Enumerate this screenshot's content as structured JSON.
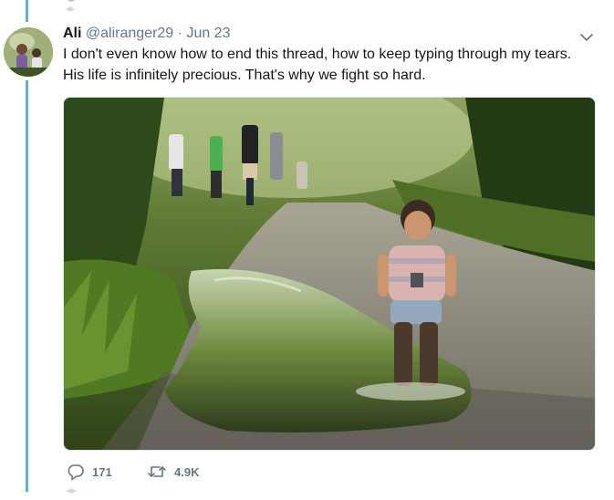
{
  "tweet": {
    "author_name": "Ali",
    "author_handle": "@aliranger29",
    "separator": "·",
    "date": "Jun 23",
    "text_lines": [
      "I don't even know how to end this thread, how to keep typing through my tears.",
      "His life is infinitely precious. That's why we fight so hard."
    ],
    "stats": {
      "replies": "171",
      "retweets": "4.9K"
    },
    "media": {
      "icon": "photo",
      "subject": "toddler walking through a puddle on a wooded dirt path"
    }
  },
  "icons": {
    "reply": "reply-icon",
    "retweet": "retweet-icon",
    "caret": "chevron-down-icon"
  },
  "colors": {
    "thread_line": "#5fb3c6",
    "secondary_text": "#657786",
    "primary_text": "#14171a"
  }
}
